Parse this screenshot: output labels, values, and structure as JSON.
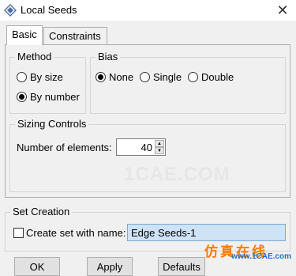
{
  "window": {
    "title": "Local Seeds",
    "close_glyph": "✕"
  },
  "tabs": [
    {
      "label": "Basic",
      "active": true
    },
    {
      "label": "Constraints",
      "active": false
    }
  ],
  "method": {
    "legend": "Method",
    "options": [
      {
        "label": "By size",
        "checked": false
      },
      {
        "label": "By number",
        "checked": true
      }
    ]
  },
  "bias": {
    "legend": "Bias",
    "options": [
      {
        "label": "None",
        "checked": true
      },
      {
        "label": "Single",
        "checked": false
      },
      {
        "label": "Double",
        "checked": false
      }
    ]
  },
  "sizing": {
    "legend": "Sizing Controls",
    "number_label": "Number of elements:",
    "number_value": "40"
  },
  "set_creation": {
    "legend": "Set Creation",
    "checkbox_label": "Create set with name:",
    "checked": false,
    "set_name": "Edge Seeds-1"
  },
  "buttons": {
    "ok": "OK",
    "apply": "Apply",
    "defaults": "Defaults"
  },
  "watermark": {
    "line1": "仿真在线",
    "line2": "www.1CAE.com",
    "bg": "1CAE.COM"
  },
  "colors": {
    "selection": "#cfe3f5",
    "watermark_orange": "#ff7a00",
    "watermark_blue": "#1e6fd0"
  }
}
